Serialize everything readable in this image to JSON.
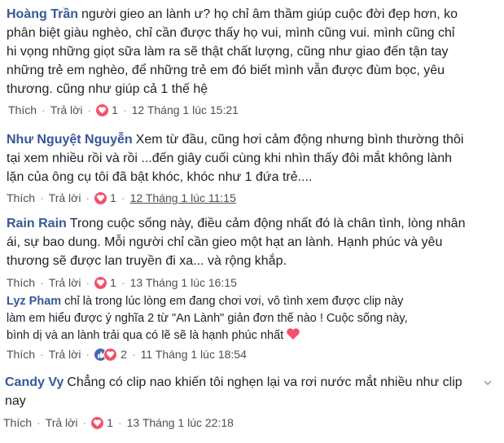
{
  "labels": {
    "like": "Thích",
    "reply": "Trả lời",
    "sep": "·"
  },
  "colors": {
    "author": "#365899",
    "love": "#f25268",
    "like": "#4267b2",
    "meta": "#4b4f56"
  },
  "comments": [
    {
      "author": "Hoàng Trần",
      "lines": [
        "người gieo an lành ư? họ chỉ âm thầm giúp cuộc đời đẹp hơn, ko",
        "phân biệt giàu nghèo, chỉ cần được thấy họ vui, mình cũng vui. mình cũng chỉ",
        "hi vọng những giọt sữa làm ra sẽ thật chất lượng, cũng như giao đến tận tay",
        "những trẻ em nghèo, để những trẻ em đó biết mình vẫn được đùm bọc, yêu",
        "thương. cũng như giúp cả 1 thế hệ"
      ],
      "reactions": [
        "love-icon"
      ],
      "reaction_count": "1",
      "timestamp": "12 Tháng 1 lúc 15:21"
    },
    {
      "author": "Như Nguyệt Nguyễn",
      "lines": [
        "Xem từ đầu, cũng hơi cảm động nhưng bình thường thôi",
        "tại xem nhiều rồi và rồi ...đến giây cuối cùng khi nhìn thấy đôi mắt không lành",
        "lặn của ông cụ tôi đã bật khóc, khóc như 1 đứa trẻ...."
      ],
      "reactions": [
        "love-icon"
      ],
      "reaction_count": "1",
      "timestamp": "12 Tháng 1 lúc 11:15"
    },
    {
      "author": "Rain Rain",
      "lines": [
        "Trong cuộc sống này, điều cảm động nhất đó là chân tình, lòng nhân",
        "ái, sự bao dung. Mỗi người chỉ cần gieo một hạt an lành. Hạnh phúc và yêu",
        "thương sẽ được lan truyền đi xa... và rộng khắp."
      ],
      "reactions": [
        "love-icon"
      ],
      "reaction_count": "1",
      "timestamp": "13 Tháng 1 lúc 16:15"
    },
    {
      "author": "Lyz Pham",
      "lines": [
        "chỉ là trong lúc lòng em đang chơi vơi, vô tình xem được clip này",
        "làm em hiểu được ý nghĩa 2 từ \"An Lành\" giản đơn thế nào ! Cuộc sống này,",
        "bình dị và an lành trải qua có lẽ sẽ là hạnh phúc nhất"
      ],
      "reactions": [
        "like-icon",
        "love-icon"
      ],
      "reaction_count": "2",
      "timestamp": "11 Tháng 1 lúc 18:54"
    },
    {
      "author": "Candy Vy",
      "lines": [
        "Chẳng có clip nao khiến tôi nghẹn lại va rơi nước mắt nhiều như clip",
        "nay"
      ],
      "reactions": [
        "love-icon"
      ],
      "reaction_count": "1",
      "timestamp": "13 Tháng 1 lúc 22:18"
    }
  ]
}
